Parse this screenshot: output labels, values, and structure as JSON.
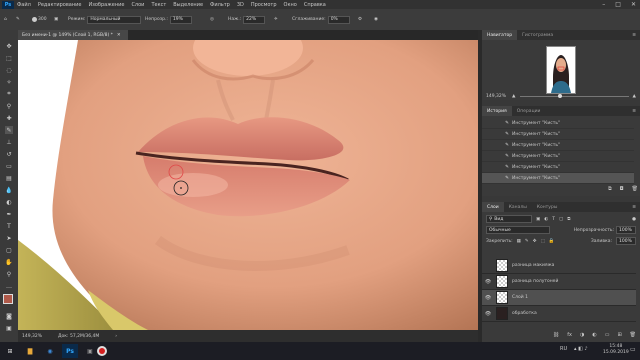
{
  "menu": {
    "app_logo": "Ps",
    "items": [
      "Файл",
      "Редактирование",
      "Изображение",
      "Слои",
      "Текст",
      "Выделение",
      "Фильтр",
      "3D",
      "Просмотр",
      "Окно",
      "Справка"
    ]
  },
  "options": {
    "brush_size": "300",
    "mode_label": "Режим:",
    "mode_value": "Нормальный",
    "opacity_label": "Непрозр.:",
    "opacity_value": "19%",
    "flow_label": "Наж.:",
    "flow_value": "22%",
    "smoothing_label": "Сглаживание:",
    "smoothing_value": "0%"
  },
  "document": {
    "tab_title": "Без имени-1 @ 149% (Слой 1, RGB/8) *",
    "status_zoom": "149,32%",
    "status_doc": "Док: 57,2M/36,4M"
  },
  "navigator": {
    "tabs": [
      "Навигатор",
      "Гистограмма"
    ],
    "zoom": "149,32%"
  },
  "history": {
    "tabs": [
      "История",
      "Операции"
    ],
    "items": [
      "Инструмент \"Кисть\"",
      "Инструмент \"Кисть\"",
      "Инструмент \"Кисть\"",
      "Инструмент \"Кисть\"",
      "Инструмент \"Кисть\"",
      "Инструмент \"Кисть\""
    ]
  },
  "layers": {
    "tabs": [
      "Слои",
      "Каналы",
      "Контуры"
    ],
    "filter_label": "Вид",
    "blend_mode": "Обычные",
    "opacity_label": "Непрозрачность:",
    "opacity_value": "100%",
    "lock_label": "Закрепить:",
    "fill_label": "Заливка:",
    "fill_value": "100%",
    "rows": [
      {
        "name": "разница макияжа"
      },
      {
        "name": "разница полутоней"
      },
      {
        "name": "Слой 1"
      },
      {
        "name": "обработка"
      }
    ]
  },
  "taskbar": {
    "lang": "RU",
    "time": "15:48",
    "date": "15.09.2019"
  }
}
